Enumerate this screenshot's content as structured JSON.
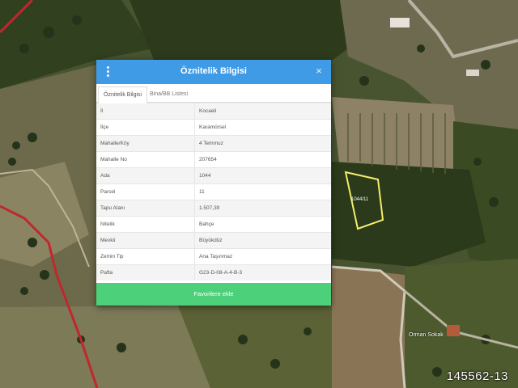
{
  "dialog": {
    "title": "Öznitelik Bilgisi",
    "close_glyph": "×",
    "tabs": [
      {
        "label": "Öznitelik Bilgisi",
        "active": true
      },
      {
        "label": "Bina/BB Listesi",
        "active": false
      }
    ],
    "rows": [
      {
        "key": "İl",
        "value": "Kocaeli"
      },
      {
        "key": "İlçe",
        "value": "Karamürsel"
      },
      {
        "key": "Mahalle/Köy",
        "value": "4 Temmuz"
      },
      {
        "key": "Mahalle No",
        "value": "207654"
      },
      {
        "key": "Ada",
        "value": "1044"
      },
      {
        "key": "Parsel",
        "value": "11"
      },
      {
        "key": "Tapu Alanı",
        "value": "1.507,39"
      },
      {
        "key": "Nitelik",
        "value": "Bahçe"
      },
      {
        "key": "Mevkii",
        "value": "Büyükdüz"
      },
      {
        "key": "Zemin Tip",
        "value": "Ana Taşınmaz"
      },
      {
        "key": "Pafta",
        "value": "G23-D-08-A-4-B-3"
      }
    ],
    "favorites_button": "Favorilere ekle"
  },
  "map": {
    "parcel_label": "1044/11",
    "street_label": "Orman Sokak",
    "colors": {
      "highlight": "#f2ee6a",
      "boundary": "#c1272d",
      "header": "#3f9be6",
      "button": "#4cd07a"
    }
  },
  "watermark": "145562-13"
}
